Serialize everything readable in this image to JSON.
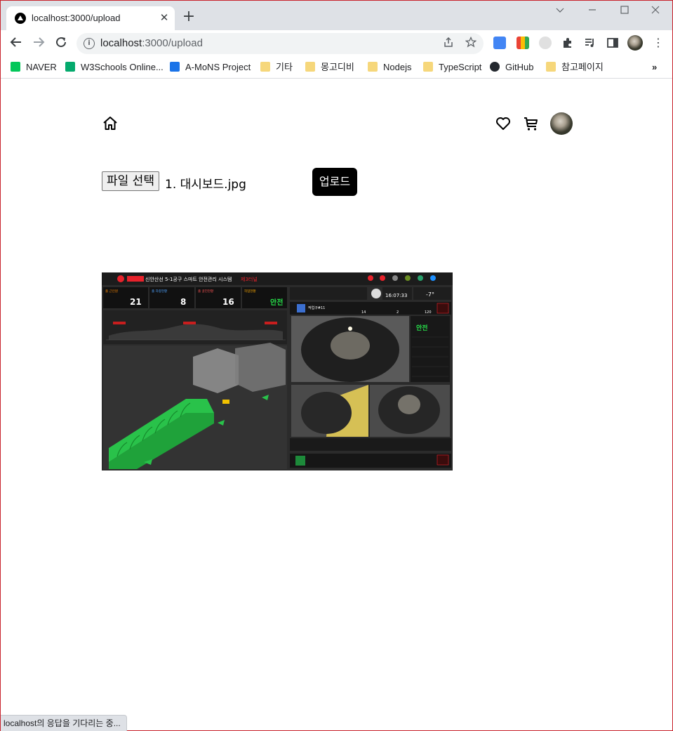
{
  "browser": {
    "tab_title": "localhost:3000/upload",
    "url_host": "localhost",
    "url_path": ":3000/upload",
    "bookmarks": [
      {
        "label": "NAVER",
        "icon": "naver-icon"
      },
      {
        "label": "W3Schools Online...",
        "icon": "w3schools-icon"
      },
      {
        "label": "A-MoNS Project",
        "icon": "amons-icon"
      },
      {
        "label": "기타",
        "icon": "folder-icon"
      },
      {
        "label": "몽고디비",
        "icon": "folder-icon"
      },
      {
        "label": "Nodejs",
        "icon": "folder-icon"
      },
      {
        "label": "TypeScript",
        "icon": "folder-icon"
      },
      {
        "label": "GitHub",
        "icon": "github-icon"
      },
      {
        "label": "참고페이지",
        "icon": "folder-icon"
      }
    ],
    "status_text": "localhost의 응답을 기다리는 중..."
  },
  "page": {
    "file_button_label": "파일 선택",
    "file_name": "1. 대시보드.jpg",
    "upload_label": "업로드"
  },
  "preview": {
    "header_title": "신안산선 5-1공구 스마트 안전관리 시스템",
    "header_suffix": "제3터널",
    "stats": [
      {
        "label": "출 근인원",
        "value": "21",
        "unit": "명"
      },
      {
        "label": "출 차량현황",
        "value": "8",
        "unit": "대"
      },
      {
        "label": "출 굴진현황",
        "value": "16",
        "unit": "%"
      },
      {
        "label": "작업현황",
        "value": "안전",
        "unit": ""
      }
    ],
    "time": "16:07:33",
    "temp": "-7°",
    "panel_title": "작업구#11",
    "panel_status": "안전",
    "panel_values": [
      "14",
      "2",
      "120"
    ]
  },
  "colors": {
    "accent": "#000000",
    "safe": "#27e04a",
    "danger": "#e8222b"
  }
}
